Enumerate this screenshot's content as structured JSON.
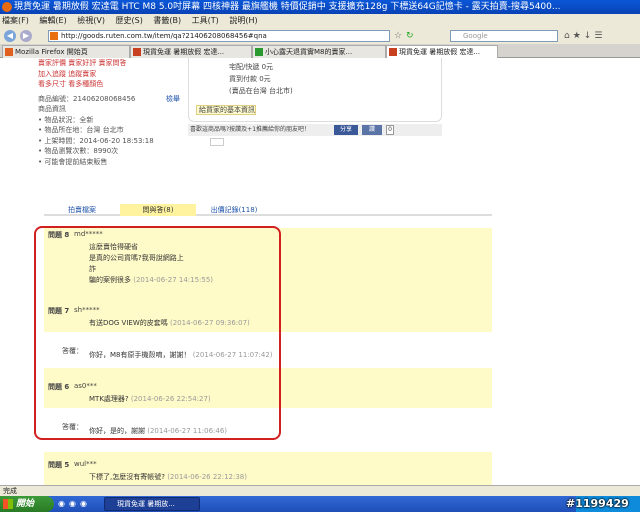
{
  "window": {
    "title": "現貨免運 暑期放假 宏達電 HTC M8 5.0吋屏幕 四核神器 最旗艦機 特價促銷中 支援擴充128g 下標送64G記憶卡 - 露天拍賣-搜尋5400..."
  },
  "menu": [
    "檔案(F)",
    "編輯(E)",
    "檢視(V)",
    "歷史(S)",
    "書籤(B)",
    "工具(T)",
    "說明(H)"
  ],
  "nav": {
    "url": "http://goods.ruten.com.tw/item/qa?21406208068456#qna",
    "search_placeholder": "Google"
  },
  "tabs": [
    {
      "label": "Mozilla Firefox 開始頁"
    },
    {
      "label": "現貨免運 暑期放假 宏達..."
    },
    {
      "label": "小心露天退貨實M8的賣家..."
    },
    {
      "label": "現貨免運 暑期放假 宏達..."
    }
  ],
  "left_info": {
    "links1": [
      "賣家評價",
      "賣家好評",
      "賣家問答"
    ],
    "links2": [
      "加入追蹤",
      "追蹤賣家"
    ],
    "links3": [
      "看多尺寸",
      "看多種顏色"
    ],
    "item_no_label": "商品編號：21406208068456",
    "report": "檢舉",
    "section": "商品資訊",
    "details": [
      "物品狀況：全新",
      "物品所在地：台灣 台北市",
      "上架時間：2014-06-20 18:53:18",
      "物品瀏覽次數：8990次",
      "可能會提前結束販售"
    ]
  },
  "info_box": {
    "shipping": "宅配/快遞   0元",
    "other": "貨到付款   0元",
    "location": "(賣品在台灣 台北市)",
    "recommend": "給買家的基本資訊"
  },
  "share": {
    "text": "喜歡這商品嗎?按讚及+1推薦給你的朋友吧！",
    "share_label": "分享",
    "like_label": "讚",
    "like_count": "0"
  },
  "qa_tabs": [
    {
      "label": "拍賣檔案"
    },
    {
      "label": "問與答(8)"
    },
    {
      "label": "出價記錄(118)"
    }
  ],
  "questions": [
    {
      "label": "問題 8",
      "user": "md*****",
      "lines": [
        "這麼賣恰得硬省",
        "是真的公司貨嗎?我哥說網路上",
        "詐",
        "騙的案例很多"
      ],
      "time": "(2014-06-27 14:15:55)"
    },
    {
      "label": "問題 7",
      "user": "sh*****",
      "lines": [
        "有送DOG VIEW的皮套嗎"
      ],
      "time": "(2014-06-27 09:36:07)",
      "answer_label": "答覆：",
      "answer": "你好，M8有原手機殼唷，謝謝！",
      "answer_time": "(2014-06-27 11:07:42)"
    },
    {
      "label": "問題 6",
      "user": "as0***",
      "lines": [
        "MTK處理器?"
      ],
      "time": "(2014-06-26 22:54:27)",
      "answer_label": "答覆：",
      "answer": "你好，是的，謝謝",
      "answer_time": "(2014-06-27 11:06:46)"
    },
    {
      "label": "問題 5",
      "user": "wul***",
      "lines": [
        "下標了,怎麼沒有寄帳號?"
      ],
      "time": "(2014-06-26 22:12:38)"
    }
  ],
  "status": "完成",
  "taskbar": {
    "start": "開始",
    "item": "現貨免運 暑期放..."
  },
  "watermark": "#1199429",
  "colors": {
    "highlight": "#fffbc8",
    "annotation": "#d02020",
    "title": "#0a57d8"
  }
}
